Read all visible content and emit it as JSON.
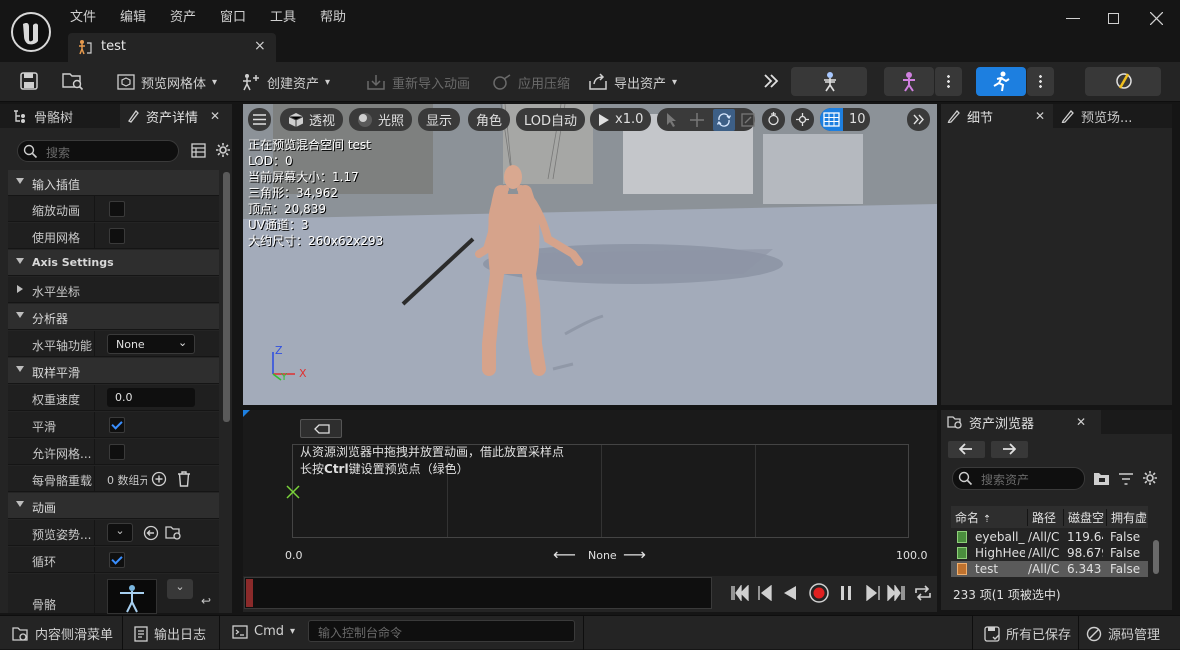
{
  "menu": [
    "文件",
    "编辑",
    "资产",
    "窗口",
    "工具",
    "帮助"
  ],
  "tab": {
    "title": "test",
    "close": "×"
  },
  "toolbar": {
    "preview_mesh": "预览网格体",
    "create_asset": "创建资产",
    "reimport": "重新导入动画",
    "apply_compress": "应用压缩",
    "export_asset": "导出资产"
  },
  "left_panel": {
    "tab_skeleton": "骨骼树",
    "tab_details": "资产详情",
    "search_placeholder": "搜索",
    "cat_input": "输入插值",
    "scale_anim": "缩放动画",
    "use_grid": "使用网格",
    "cat_axis": "Axis Settings",
    "horizontal_axis": "水平坐标",
    "cat_analyzer": "分析器",
    "horiz_axis_func": "水平轴功能",
    "horiz_axis_func_val": "None",
    "cat_sample": "取样平滑",
    "weight_speed": "权重速度",
    "weight_speed_val": "0.0",
    "smooth": "平滑",
    "allow_grid": "允许网格...",
    "per_bone": "每骨骼重载",
    "per_bone_val": "0 数组元素",
    "cat_anim": "动画",
    "preview_pose": "预览姿势...",
    "loop": "循环",
    "skeleton": "骨骼"
  },
  "viewport": {
    "btn_perspective": "透视",
    "btn_lit": "光照",
    "btn_show": "显示",
    "btn_character": "角色",
    "btn_lod": "LOD自动",
    "btn_speed": "x1.0",
    "grid_num": "10",
    "stats": [
      "正在预览混合空间 test",
      "LOD：0",
      "当前屏幕大小：1.17",
      "三角形：34,962",
      "顶点：20,839",
      "UV通道：3",
      "大约尺寸：260x62x293"
    ],
    "axis_x": "X",
    "axis_y": "Y",
    "axis_z": "Z"
  },
  "blend": {
    "hint1": "从资源浏览器中拖拽并放置动画，借此放置采样点",
    "hint2_pre": "长按",
    "hint2_key": "Ctrl",
    "hint2_post": "键设置预览点（绿色）",
    "min": "0.0",
    "max": "100.0",
    "axis_name": "None"
  },
  "right_panel": {
    "tab_details": "细节",
    "tab_preview": "预览场..."
  },
  "asset_browser": {
    "title": "资产浏览器",
    "search_placeholder": "搜索资产",
    "headers": [
      "命名",
      "路径",
      "磁盘空",
      "拥有虚"
    ],
    "rows": [
      {
        "name": "eyeball_",
        "path": "/All/C",
        "size": "119.64",
        "virt": "False"
      },
      {
        "name": "HighHee",
        "path": "/All/C",
        "size": "98.679",
        "virt": "False"
      },
      {
        "name": "test",
        "path": "/All/C",
        "size": "6.343",
        "virt": "False"
      }
    ],
    "count": "233 项(1 项被选中)"
  },
  "statusbar": {
    "content_drawer": "内容侧滑菜单",
    "output_log": "输出日志",
    "cmd": "Cmd",
    "console_placeholder": "输入控制台命令",
    "all_saved": "所有已保存",
    "source_control": "源码管理"
  }
}
